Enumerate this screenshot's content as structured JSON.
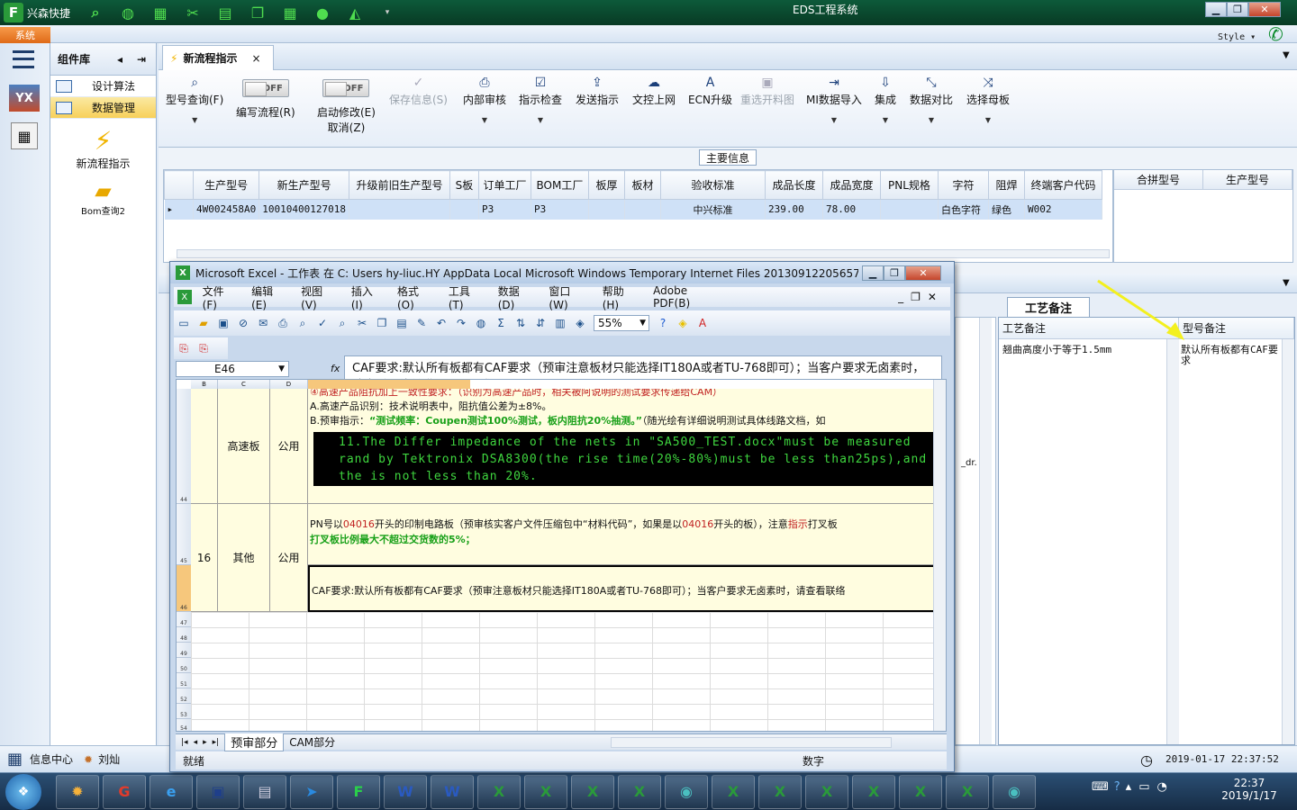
{
  "app": {
    "title_short": "兴森快捷",
    "window_title": "EDS工程系统",
    "system_tab": "系统",
    "style_label": "Style"
  },
  "sidebar": {
    "header": "组件库",
    "items": [
      {
        "label": "设计算法"
      },
      {
        "label": "数据管理"
      }
    ],
    "big_items": [
      {
        "label": "新流程指示"
      },
      {
        "label": "Bom查询2"
      }
    ]
  },
  "doc": {
    "tab_label": "新流程指示"
  },
  "toolbar": {
    "query": "型号查询(F)",
    "edit_flow": "编写流程(R)",
    "edit_flow_toggle": "OFF",
    "start_modify": "启动修改(E)",
    "start_modify_toggle": "OFF",
    "cancel": "取消(Z)",
    "save": "保存信息(S)",
    "internal_review": "内部审核",
    "check": "指示检查",
    "send": "发送指示",
    "upload": "文控上网",
    "ecn": "ECN升级",
    "reselect": "重选开料图",
    "mi_import": "MI数据导入",
    "integrate": "集成",
    "compare": "数据对比",
    "select_mother": "选择母板"
  },
  "main_info": {
    "label": "主要信息",
    "columns": [
      "生产型号",
      "新生产型号",
      "升级前旧生产型号",
      "S板",
      "订单工厂",
      "BOM工厂",
      "板厚",
      "板材",
      "验收标准",
      "成品长度",
      "成品宽度",
      "PNL规格",
      "字符",
      "阻焊",
      "终端客户代码"
    ],
    "row": [
      "4W002458A0",
      "10010400127018",
      "",
      "",
      "P3",
      "P3",
      "",
      "",
      "中兴标准",
      "239.00",
      "78.00",
      "",
      "白色字符",
      "绿色",
      "W002"
    ],
    "side_columns": [
      "合拼型号",
      "生产型号"
    ]
  },
  "remarks": {
    "tab": "工艺备注",
    "col1": "工艺备注",
    "col2": "型号备注",
    "col1_text": "翘曲高度小于等于1.5mm",
    "col2_text": "默认所有板都有CAF要求"
  },
  "excel": {
    "title": "Microsoft Excel - 工作表 在 C: Users hy-liuc.HY AppData Local Microsoft Windows Temporary Internet Files 201309122056573...",
    "menus": [
      "文件(F)",
      "编辑(E)",
      "视图(V)",
      "插入(I)",
      "格式(O)",
      "工具(T)",
      "数据(D)",
      "窗口(W)",
      "帮助(H)",
      "Adobe PDF(B)"
    ],
    "zoom": "55%",
    "namebox": "E46",
    "fx": "fx",
    "formula": "CAF要求:默认所有板都有CAF要求（预审注意板材只能选择IT180A或者TU-768即可）；当客户要求无卤素时，请查看联络单满足CAF要求。",
    "col_headers": [
      "B",
      "C",
      "D"
    ],
    "rows": {
      "r44": {
        "num": "44",
        "c": "高速板",
        "d": "公用",
        "line1": "④高速产品阻抗加上一致性要求：（识别为高速产品时，相关被阿说明的测试要求传递给CAM）",
        "line2": "A.高速产品识别：技术说明表中，阻抗值公差为±8%。",
        "line3_prefix": "B.预审指示：",
        "line3_bold": "“测试频率：Coupen测试100%测试，板内阻抗20%抽测。”",
        "line3_suffix": "（随光绘有详细说明测试具体线路文档，如",
        "black_box": "11.The Differ impedance of the nets in \"SA500_TEST.docx\"must be measured rand by Tektronix DSA8300(the rise time(20%-80%)must be less than25ps),and the is not less than 20%."
      },
      "r45": {
        "num": "45",
        "b": "16",
        "c": "其他",
        "d": "公用",
        "line1_a": "PN号以",
        "line1_red1": "04016",
        "line1_b": "开头的印制电路板（预审核实客户文件压缩包中“材料代码”，如果是以",
        "line1_red2": "04016",
        "line1_c": "开头的板），注意",
        "line1_red3": "指示",
        "line1_d": "打叉板",
        "line2": "打叉板比例最大不超过交货数的5%；"
      },
      "r46": {
        "num": "46",
        "text": "CAF要求:默认所有板都有CAF要求（预审注意板材只能选择IT180A或者TU-768即可）；当客户要求无卤素时，请查看联络"
      },
      "empty": [
        "47",
        "48",
        "49",
        "50",
        "51",
        "52",
        "53",
        "54"
      ]
    },
    "sheet_tabs": [
      "预审部分",
      "CAM部分"
    ],
    "status_ready": "就绪",
    "status_num": "数字",
    "dr_fragment": "_dr."
  },
  "statusbar": {
    "info": "信息中心",
    "user": "刘灿",
    "datetime": "2019-01-17  22:37:52"
  },
  "taskbar": {
    "time": "22:37",
    "date": "2019/1/17"
  }
}
